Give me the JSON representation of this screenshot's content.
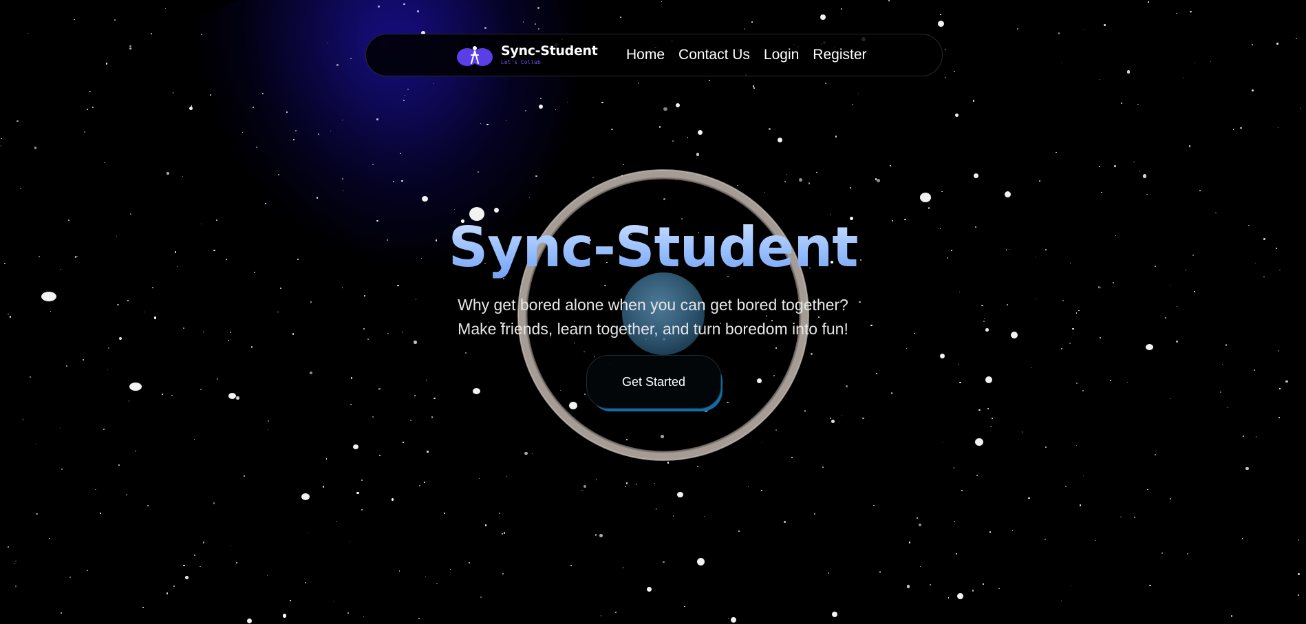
{
  "brand": {
    "name": "Sync-Student",
    "tagline": "Let's Collab",
    "logo_icon": "person-infinity-icon",
    "logo_color": "#5a3ee8"
  },
  "nav": {
    "items": [
      {
        "label": "Home"
      },
      {
        "label": "Contact Us"
      },
      {
        "label": "Login"
      },
      {
        "label": "Register"
      }
    ]
  },
  "hero": {
    "title": "Sync-Student",
    "subtitle_line1": "Why get bored alone when you can get bored together?",
    "subtitle_line2": "Make friends, learn together, and turn boredom into fun!",
    "cta_label": "Get Started"
  },
  "colors": {
    "background": "#000000",
    "title_gradient_top": "#d6e6ff",
    "title_gradient_bottom": "#6f9cf2",
    "cta_shadow": "#0e6fa8",
    "nebula": "#140a78"
  }
}
